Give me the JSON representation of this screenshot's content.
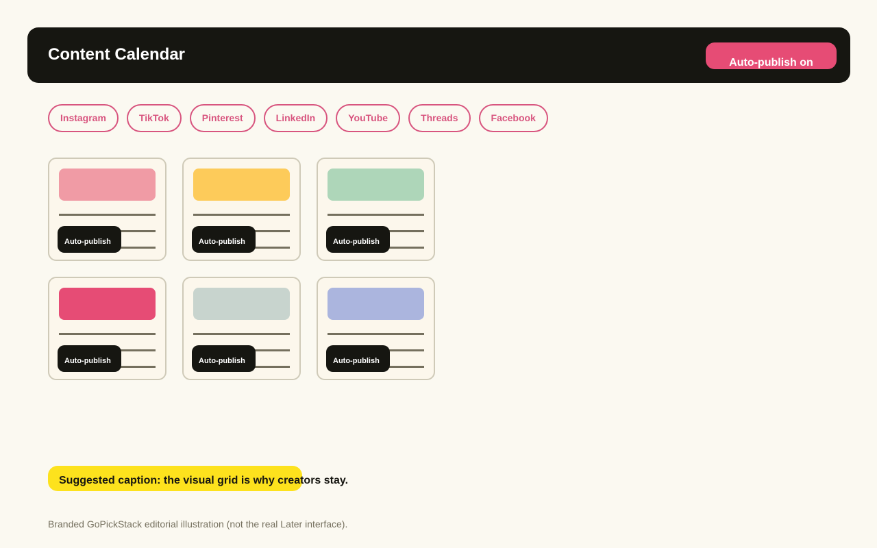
{
  "header": {
    "title": "Content Calendar",
    "action_label": "Auto-publish on",
    "background": "#161611",
    "accent": "#e64c75"
  },
  "platforms": [
    {
      "label": "Instagram"
    },
    {
      "label": "TikTok"
    },
    {
      "label": "Pinterest"
    },
    {
      "label": "LinkedIn"
    },
    {
      "label": "YouTube"
    },
    {
      "label": "Threads"
    },
    {
      "label": "Facebook"
    }
  ],
  "cards": [
    {
      "color": "#f09ba5",
      "badge": "Auto-publish"
    },
    {
      "color": "#fdcb5a",
      "badge": "Auto-publish"
    },
    {
      "color": "#aed6b9",
      "badge": "Auto-publish"
    },
    {
      "color": "#e64c75",
      "badge": "Auto-publish"
    },
    {
      "color": "#c8d4ce",
      "badge": "Auto-publish"
    },
    {
      "color": "#abb5de",
      "badge": "Auto-publish"
    }
  ],
  "caption": {
    "text": "Suggested caption: the visual grid is why creators stay.",
    "highlight_color": "#fde21d"
  },
  "footnote": "Branded GoPickStack editorial illustration (not the real Later interface)."
}
